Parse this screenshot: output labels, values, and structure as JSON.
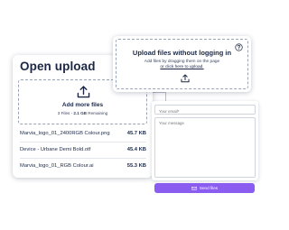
{
  "open_upload": {
    "title": "Open upload",
    "drop_zone": {
      "icon": "upload-icon",
      "label": "Add more files",
      "files_count": "3 Files",
      "separator": " - ",
      "storage": "2.1 GB",
      "remaining": " Remaining"
    },
    "files": [
      {
        "name": "Marvia_logo_01_2400RGB Colour.png",
        "size": "45.7 KB"
      },
      {
        "name": "Device - Urbane Demi Bold.otf",
        "size": "45.4 KB"
      },
      {
        "name": "Marvia_logo_01_RGB Colour.ai",
        "size": "55.3 KB"
      }
    ]
  },
  "no_login_upload": {
    "title": "Upload files without logging in",
    "line1": "Add files by dragging them on the page",
    "line2": "or click here to upload.",
    "help_icon": "question-circle-icon",
    "upload_icon": "upload-icon"
  },
  "form": {
    "email_placeholder": "Your email*",
    "message_placeholder": "Your message",
    "send_label": "Send files",
    "send_icon": "envelope-icon"
  },
  "colors": {
    "accent": "#8b5cf0",
    "text_dark": "#1b2744",
    "border_dashed": "#9aa3b5"
  }
}
